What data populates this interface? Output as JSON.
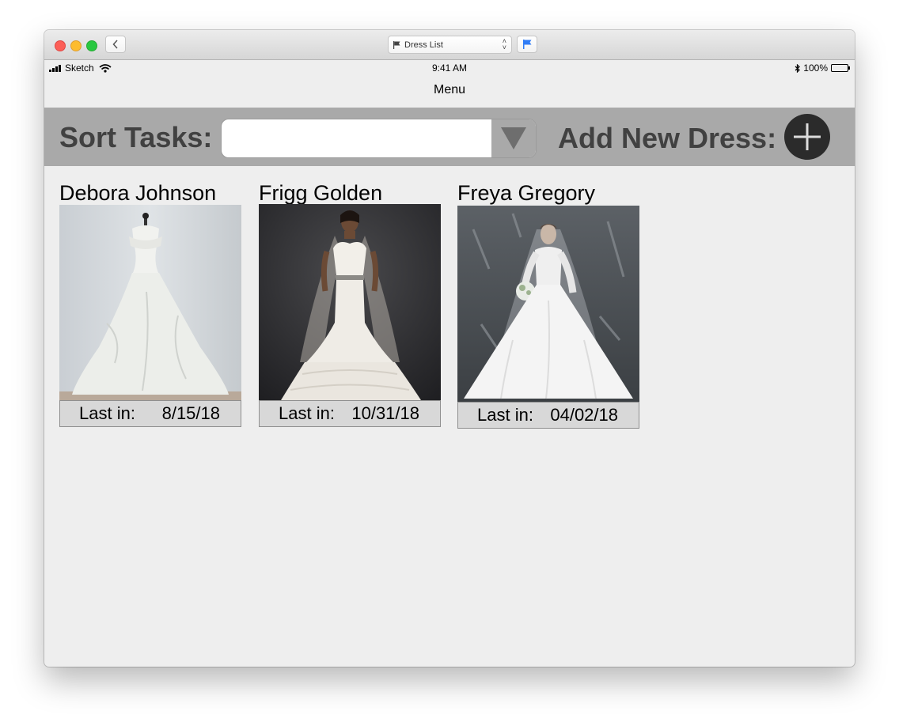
{
  "window": {
    "page_selector": "Dress List"
  },
  "status_bar": {
    "carrier": "Sketch",
    "time": "9:41 AM",
    "battery": "100%"
  },
  "header": {
    "title": "Menu"
  },
  "toolbar": {
    "sort_label": "Sort Tasks:",
    "sort_value": "",
    "add_label": "Add New Dress:"
  },
  "dresses": [
    {
      "name": "Debora Johnson",
      "last_in_label": "Last in:",
      "last_in_date": "8/15/18"
    },
    {
      "name": "Frigg Golden",
      "last_in_label": "Last in:",
      "last_in_date": "10/31/18"
    },
    {
      "name": "Freya Gregory",
      "last_in_label": "Last in:",
      "last_in_date": "04/02/18"
    }
  ],
  "colors": {
    "toolbar_bg": "#a9a9a9",
    "label_text": "#414141",
    "add_button": "#2b2b2b",
    "card_footer": "#d8d8d8"
  }
}
